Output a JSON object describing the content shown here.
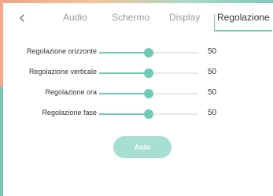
{
  "tabs": {
    "items": [
      {
        "label": "Audio"
      },
      {
        "label": "Schermo"
      },
      {
        "label": "Display"
      },
      {
        "label": "Regolazione",
        "active": true
      }
    ]
  },
  "settings": {
    "rows": [
      {
        "label": "Regolazione orizzonte",
        "value": "50",
        "level": 0.5
      },
      {
        "label": "Regolazione verticale",
        "value": "50",
        "level": 0.5
      },
      {
        "label": "Regolazione ora",
        "value": "50",
        "level": 0.5
      },
      {
        "label": "Regolazione fase",
        "value": "50",
        "level": 0.5
      }
    ],
    "auto_label": "Auto"
  },
  "colors": {
    "accent": "#6fcab6",
    "button": "#a7dfd3",
    "track": "#e8e8e8"
  },
  "icons": {
    "back": "chevron-left-icon"
  }
}
